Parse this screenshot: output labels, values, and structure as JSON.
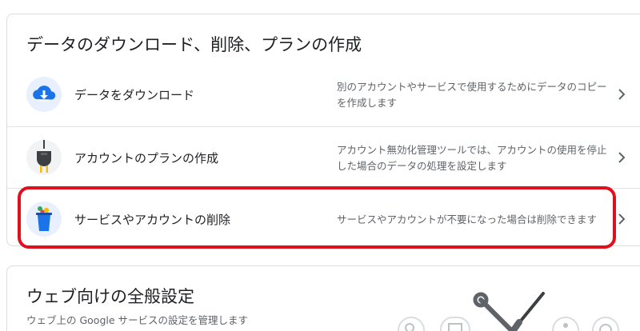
{
  "data_section": {
    "title": "データのダウンロード、削除、プランの作成",
    "rows": [
      {
        "label": "データをダウンロード",
        "description": "別のアカウントやサービスで使用するためにデータのコピーを作成します",
        "icon": "cloud-download-icon"
      },
      {
        "label": "アカウントのプランの作成",
        "description": "アカウント無効化管理ツールでは、アカウントの使用を停止した場合のデータの処理を設定します",
        "icon": "plug-icon"
      },
      {
        "label": "サービスやアカウントの削除",
        "description": "サービスやアカウントが不要になった場合は削除できます",
        "icon": "trash-icon"
      }
    ],
    "highlight_color": "#e0101c"
  },
  "web_settings": {
    "title": "ウェブ向けの全般設定",
    "subtitle": "ウェブ上の Google サービスの設定を管理します",
    "illustration": "tools-illustration"
  }
}
